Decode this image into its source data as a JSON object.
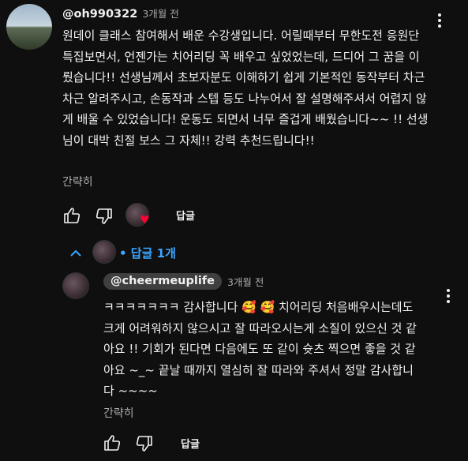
{
  "comment": {
    "handle": "@oh990322",
    "time": "3개월 전",
    "body": "원데이 클래스 참여해서 배운 수강생입니다. 어릴때부터 무한도전 응원단 특집보면서, 언젠가는 치어리딩 꼭 배우고 싶었었는데,  드디어 그 꿈을 이뤘습니다!! 선생님께서 초보자분도 이해하기 쉽게 기본적인 동작부터 차근차근 알려주시고, 손동작과 스텝 등도 나누어서 잘 설명해주셔서 어렵지 않게 배울 수 있었습니다! 운동도 되면서 너무 즐겁게 배웠습니다~~ !! 선생님이 대박 친절 보스 그 자체!! 강력 추천드립니다!!",
    "read_less": "간략히",
    "reply_label": "답글",
    "replies_toggle": "• 답글 1개"
  },
  "reply": {
    "handle": "@cheermeuplife",
    "time": "3개월 전",
    "body": "ㅋㅋㅋㅋㅋㅋㅋ 감사합니다 🥰 🥰  치어리딩 처음배우시는데도 크게 어려워하지 않으시고 잘 따라오시는게 소질이 있으신 것 같아요 !! 기회가 된다면 다음에도 또 같이 슛츠 찍으면 좋을 것 같아요 ~_~ 끝날 때까지 열심히 잘 따라와 주셔서 정말 감사합니다 ~~~~",
    "read_less": "간략히",
    "reply_label": "답글"
  },
  "icons": {
    "like": "thumbs-up-icon",
    "dislike": "thumbs-down-icon",
    "more": "more-vert-icon",
    "chevron": "chevron-up-icon",
    "heart": "creator-heart-icon"
  },
  "colors": {
    "background": "#0f0f0f",
    "text": "#f1f1f1",
    "muted": "#aaaaaa",
    "link": "#3ea6ff",
    "heart": "#ff0033",
    "chip": "#3f3f3f"
  }
}
